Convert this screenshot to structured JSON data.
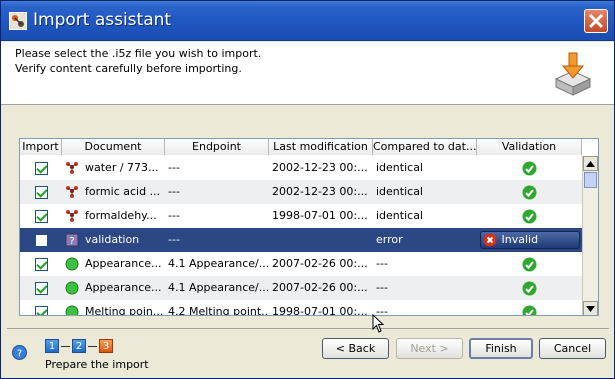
{
  "window": {
    "title": "Import assistant"
  },
  "header": {
    "line1": "Please select the .i5z file you wish to import.",
    "line2": "Verify content carefully before importing."
  },
  "table": {
    "columns": [
      "Import",
      "Document",
      "Endpoint",
      "Last modification",
      "Compared to dat...",
      "Validation"
    ],
    "rows": [
      {
        "checked": true,
        "doc_icon": "molecule-icon",
        "document": "water / 773...",
        "endpoint": "---",
        "modified": "2002-12-23 00:...",
        "compared": "identical",
        "validation": "ok"
      },
      {
        "checked": true,
        "doc_icon": "molecule-icon",
        "document": "formic acid ...",
        "endpoint": "---",
        "modified": "2002-12-23 00:...",
        "compared": "identical",
        "validation": "ok"
      },
      {
        "checked": true,
        "doc_icon": "molecule-icon",
        "document": "formaldehy...",
        "endpoint": "---",
        "modified": "1998-07-01 00:...",
        "compared": "identical",
        "validation": "ok"
      },
      {
        "checked": false,
        "doc_icon": "unknown-doc-icon",
        "document": "validation",
        "endpoint": "---",
        "modified": "",
        "compared": "error",
        "validation": "Invalid",
        "selected": true
      },
      {
        "checked": true,
        "doc_icon": "green-circle-icon",
        "document": "Appearance...",
        "endpoint": "4.1 Appearance/...",
        "modified": "2007-02-26 00:...",
        "compared": "---",
        "validation": "ok"
      },
      {
        "checked": true,
        "doc_icon": "green-circle-icon",
        "document": "Appearance...",
        "endpoint": "4.1 Appearance/...",
        "modified": "2007-02-26 00:...",
        "compared": "---",
        "validation": "ok"
      },
      {
        "checked": true,
        "doc_icon": "green-circle-icon",
        "document": "Melting poin...",
        "endpoint": "4.2 Melting point...",
        "modified": "1998-07-01 00:...",
        "compared": "---",
        "validation": "ok"
      }
    ]
  },
  "wizard": {
    "steps": [
      "1",
      "2",
      "3"
    ],
    "current_step_label": "Prepare the import"
  },
  "buttons": {
    "back": "< Back",
    "next": "Next >",
    "finish": "Finish",
    "cancel": "Cancel"
  },
  "colors": {
    "title_bar": "#1f57c0",
    "selected_row": "#2b4884",
    "ok_green": "#2fa82f",
    "error_red": "#d9301c"
  }
}
